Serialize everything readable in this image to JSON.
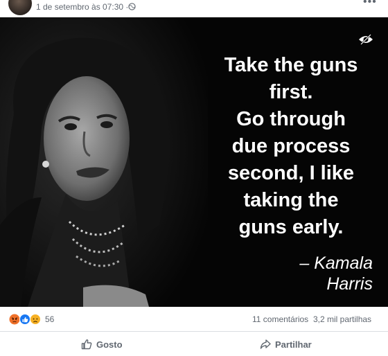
{
  "post": {
    "timestamp": "1 de setembro às 07:30 ·",
    "more_icon": "ellipsis-horizontal-icon",
    "privacy_icon": "globe-icon"
  },
  "image": {
    "hide_icon": "eye-slash-icon",
    "quote_lines": [
      "Take the guns",
      "first.",
      "Go through",
      "due process",
      "second, I like",
      "taking the",
      "guns early."
    ],
    "author_line1": "– Kamala",
    "author_line2": "Harris"
  },
  "stats": {
    "reaction_icons": [
      "angry-icon",
      "like-icon",
      "sad-icon"
    ],
    "reaction_count": "56",
    "comments": "11 comentários",
    "shares": "3,2 mil partilhas"
  },
  "actions": {
    "like_label": "Gosto",
    "share_label": "Partilhar"
  },
  "colors": {
    "secondary_text": "#606770",
    "divider": "#dadde1",
    "like_blue": "#1877f2",
    "angry_orange": "#f0712a",
    "sad_yellow": "#f7b125"
  }
}
